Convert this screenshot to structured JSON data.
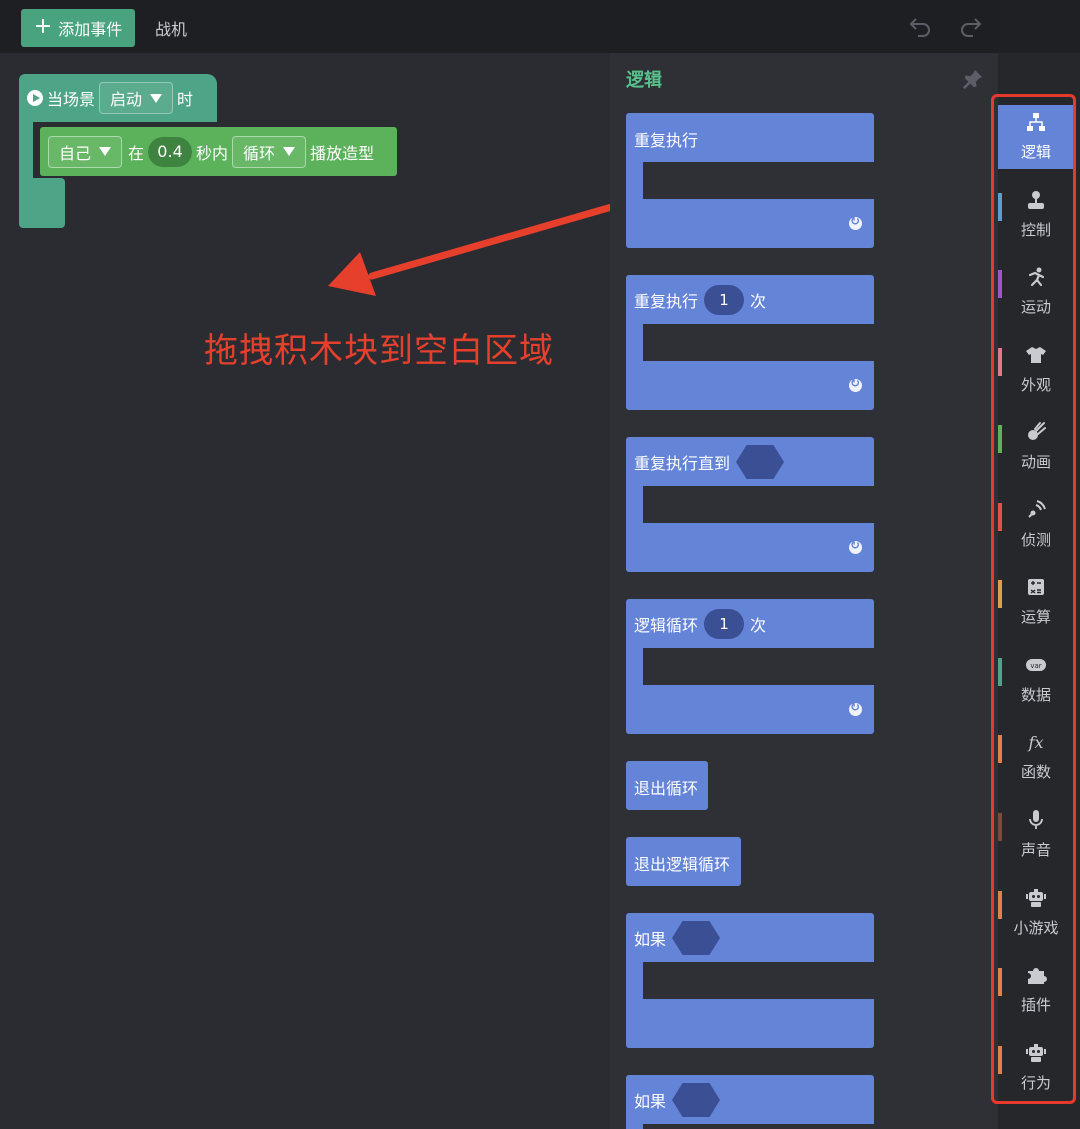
{
  "toolbar": {
    "add_event_label": "添加事件",
    "target_name": "战机"
  },
  "workspace": {
    "hat_block": {
      "text_when": "当场景",
      "dropdown": "启动",
      "text_then": "时"
    },
    "anim_block": {
      "dropdown_who": "自己",
      "text_in": "在",
      "seconds": "0.4",
      "text_seconds": "秒内",
      "dropdown_mode": "循环",
      "text_action": "播放造型"
    },
    "hint_text": "拖拽积木块到空白区域"
  },
  "palette": {
    "title": "逻辑",
    "blocks": [
      {
        "label": "重复执行"
      },
      {
        "label": "重复执行",
        "count": "1",
        "suffix": "次"
      },
      {
        "label": "重复执行直到"
      },
      {
        "label": "逻辑循环",
        "count": "1",
        "suffix": "次"
      },
      {
        "label": "退出循环"
      },
      {
        "label": "退出逻辑循环"
      },
      {
        "label": "如果"
      },
      {
        "label": "如果"
      }
    ]
  },
  "categories": [
    {
      "label": "逻辑",
      "icon": "hierarchy-icon",
      "color": "#6484d8"
    },
    {
      "label": "控制",
      "icon": "joystick-icon",
      "color": "#5a9fd4"
    },
    {
      "label": "运动",
      "icon": "running-icon",
      "color": "#9b59c8"
    },
    {
      "label": "外观",
      "icon": "shirt-icon",
      "color": "#e07a8a"
    },
    {
      "label": "动画",
      "icon": "comet-icon",
      "color": "#5cb25b"
    },
    {
      "label": "侦测",
      "icon": "signal-icon",
      "color": "#e0514a"
    },
    {
      "label": "运算",
      "icon": "calculator-icon",
      "color": "#e0a04a"
    },
    {
      "label": "数据",
      "icon": "var-icon",
      "color": "#4ea486"
    },
    {
      "label": "函数",
      "icon": "fx-icon",
      "color": "#e0804a"
    },
    {
      "label": "声音",
      "icon": "microphone-icon",
      "color": "#7a4a3a"
    },
    {
      "label": "小游戏",
      "icon": "robot-icon",
      "color": "#e0804a"
    },
    {
      "label": "插件",
      "icon": "puzzle-icon",
      "color": "#e0804a"
    },
    {
      "label": "行为",
      "icon": "robot-icon",
      "color": "#e0804a"
    }
  ],
  "colors": {
    "accent_green": "#4aa37f",
    "logic_blue": "#6484d8",
    "annotation_red": "#e6402d"
  }
}
